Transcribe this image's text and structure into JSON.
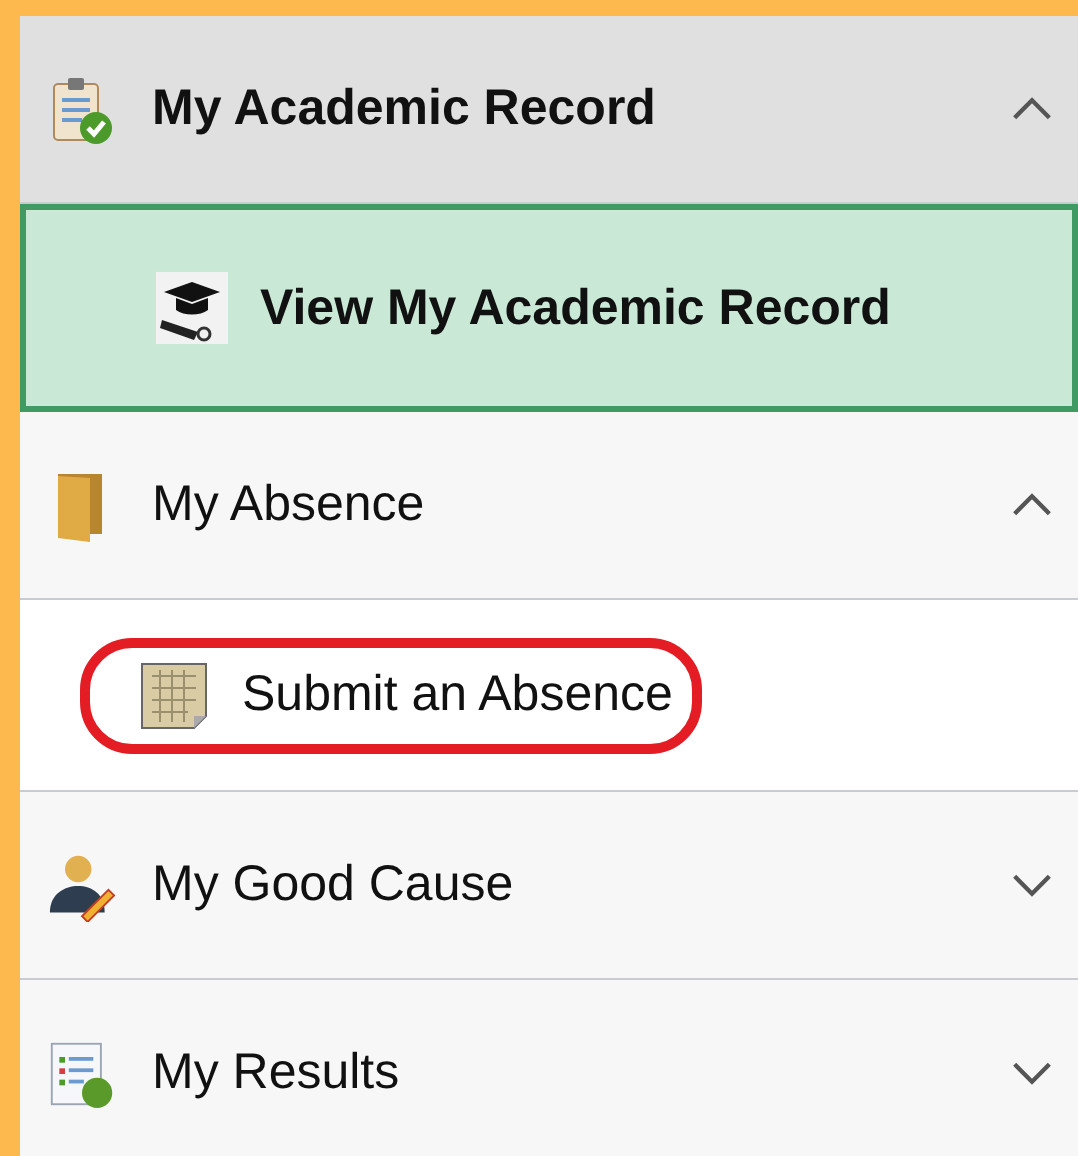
{
  "sections": [
    {
      "title": "My Academic Record",
      "selected": true,
      "expanded": true,
      "children": [
        {
          "label": "View My Academic Record",
          "selected": true,
          "highlighted": false
        }
      ]
    },
    {
      "title": "My Absence",
      "selected": false,
      "expanded": true,
      "children": [
        {
          "label": "Submit an Absence",
          "selected": false,
          "highlighted": true
        }
      ]
    },
    {
      "title": "My Good Cause",
      "selected": false,
      "expanded": false
    },
    {
      "title": "My Results",
      "selected": false,
      "expanded": false
    }
  ]
}
